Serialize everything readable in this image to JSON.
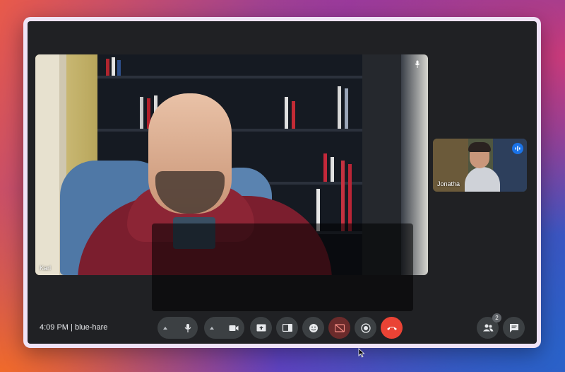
{
  "participants": {
    "main": {
      "name": "Karl"
    },
    "side": {
      "name": "Jonatha"
    },
    "count": "2"
  },
  "meeting": {
    "time": "4:09 PM",
    "separator": "|",
    "code": "blue-hare"
  },
  "controls": {
    "mic_icon": "mic-icon",
    "camera_icon": "camera-icon",
    "present_icon": "present-screen-icon",
    "layout_icon": "layout-icon",
    "reactions_icon": "emoji-icon",
    "captions_icon": "captions-off-icon",
    "record_icon": "record-icon",
    "hangup_icon": "hang-up-icon",
    "people_icon": "people-icon",
    "chat_icon": "chat-icon"
  },
  "colors": {
    "hangup": "#ea4335",
    "toolbar_bg": "#3c4043",
    "active_speaker": "#1a73e8"
  }
}
